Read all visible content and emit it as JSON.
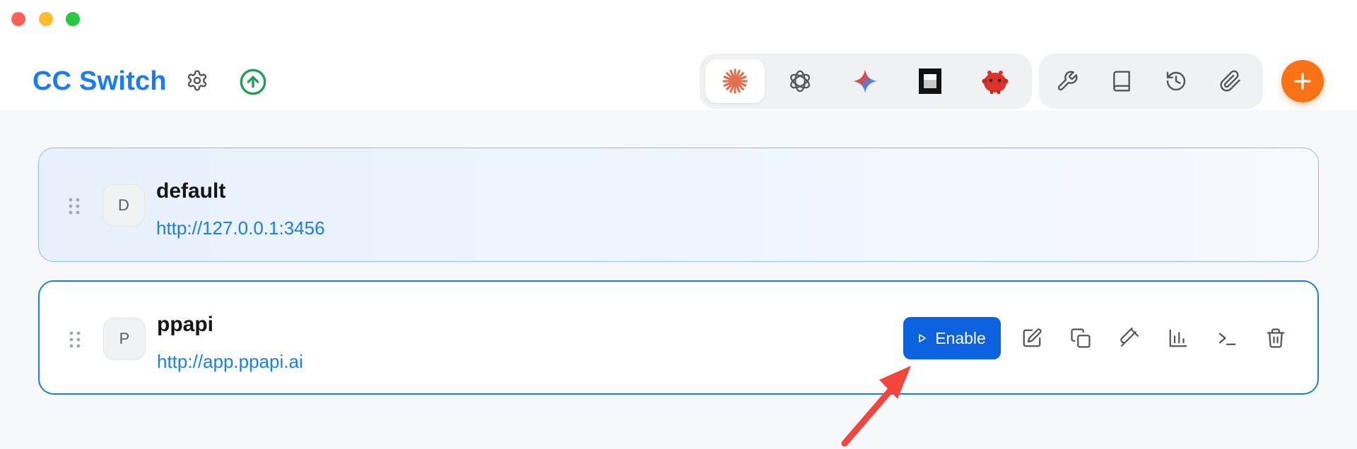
{
  "window": {
    "buttons": [
      "close",
      "minimize",
      "zoom"
    ]
  },
  "header": {
    "title": "CC Switch",
    "settings_icon": "gear-icon",
    "update_icon": "arrow-up-circle-icon",
    "app_tabs": [
      {
        "icon": "claude-icon",
        "active": true
      },
      {
        "icon": "openai-icon",
        "active": false
      },
      {
        "icon": "gemini-icon",
        "active": false
      },
      {
        "icon": "terminal-app-icon",
        "active": false
      },
      {
        "icon": "red-mascot-icon",
        "active": false
      }
    ],
    "tools": [
      "wrench-icon",
      "book-icon",
      "history-icon",
      "paperclip-icon"
    ],
    "add_icon": "plus-icon"
  },
  "providers": [
    {
      "avatar": "D",
      "name": "default",
      "url": "http://127.0.0.1:3456",
      "active": true
    },
    {
      "avatar": "P",
      "name": "ppapi",
      "url": "http://app.ppapi.ai",
      "active": false
    }
  ],
  "actions": {
    "enable_label": "Enable",
    "icons": [
      "edit-icon",
      "duplicate-icon",
      "test-icon",
      "usage-chart-icon",
      "terminal-icon",
      "delete-icon"
    ]
  },
  "colors": {
    "accent": "#1a7cf2",
    "enable_button": "#0d62e0",
    "add_button": "#f97316",
    "url": "#1c7ee8"
  }
}
